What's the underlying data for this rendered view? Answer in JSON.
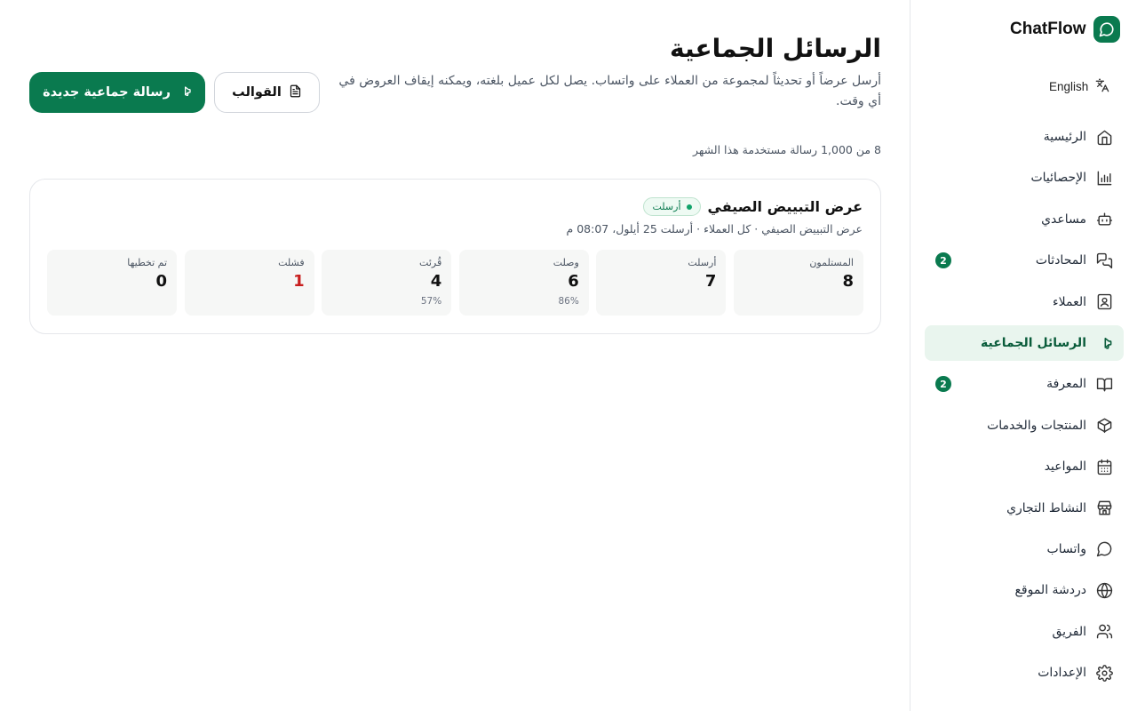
{
  "brand": {
    "name": "ChatFlow"
  },
  "language": {
    "label": "English"
  },
  "sidebar": {
    "items": [
      {
        "label": "الرئيسية",
        "icon": "home-icon"
      },
      {
        "label": "الإحصائيات",
        "icon": "stats-icon"
      },
      {
        "label": "مساعدي",
        "icon": "bot-icon"
      },
      {
        "label": "المحادثات",
        "icon": "chat-icon",
        "badge": "2"
      },
      {
        "label": "العملاء",
        "icon": "contacts-icon"
      },
      {
        "label": "الرسائل الجماعية",
        "icon": "megaphone-icon",
        "active": true
      },
      {
        "label": "المعرفة",
        "icon": "book-icon",
        "badge": "2"
      },
      {
        "label": "المنتجات والخدمات",
        "icon": "box-icon"
      },
      {
        "label": "المواعيد",
        "icon": "calendar-icon"
      },
      {
        "label": "النشاط التجاري",
        "icon": "store-icon"
      },
      {
        "label": "واتساب",
        "icon": "message-circle-icon"
      },
      {
        "label": "دردشة الموقع",
        "icon": "globe-icon"
      },
      {
        "label": "الفريق",
        "icon": "team-icon"
      },
      {
        "label": "الإعدادات",
        "icon": "settings-icon"
      }
    ]
  },
  "header": {
    "title": "الرسائل الجماعية",
    "subtitle": "أرسل عرضاً أو تحديثاً لمجموعة من العملاء على واتساب. يصل لكل عميل بلغته، ويمكنه إيقاف العروض في أي وقت.",
    "new_broadcast_label": "رسالة جماعية جديدة",
    "templates_label": "القوالب"
  },
  "usage": {
    "text": "8 من 1,000 رسالة مستخدمة هذا الشهر"
  },
  "broadcast": {
    "title": "عرض التبييض الصيفي",
    "status": "أرسلت",
    "meta": "عرض التبييض الصيفي · كل العملاء · أرسلت 25 أيلول، 08:07 م",
    "stats": [
      {
        "label": "المستلمون",
        "value": "8",
        "pct": ""
      },
      {
        "label": "أرسلت",
        "value": "7",
        "pct": ""
      },
      {
        "label": "وصلت",
        "value": "6",
        "pct": "86%"
      },
      {
        "label": "قُرئت",
        "value": "4",
        "pct": "57%"
      },
      {
        "label": "فشلت",
        "value": "1",
        "pct": "",
        "color": "#c81e1e"
      },
      {
        "label": "تم تخطيها",
        "value": "0",
        "pct": ""
      }
    ]
  },
  "colors": {
    "accent": "#0a7a4f",
    "danger": "#c81e1e"
  }
}
